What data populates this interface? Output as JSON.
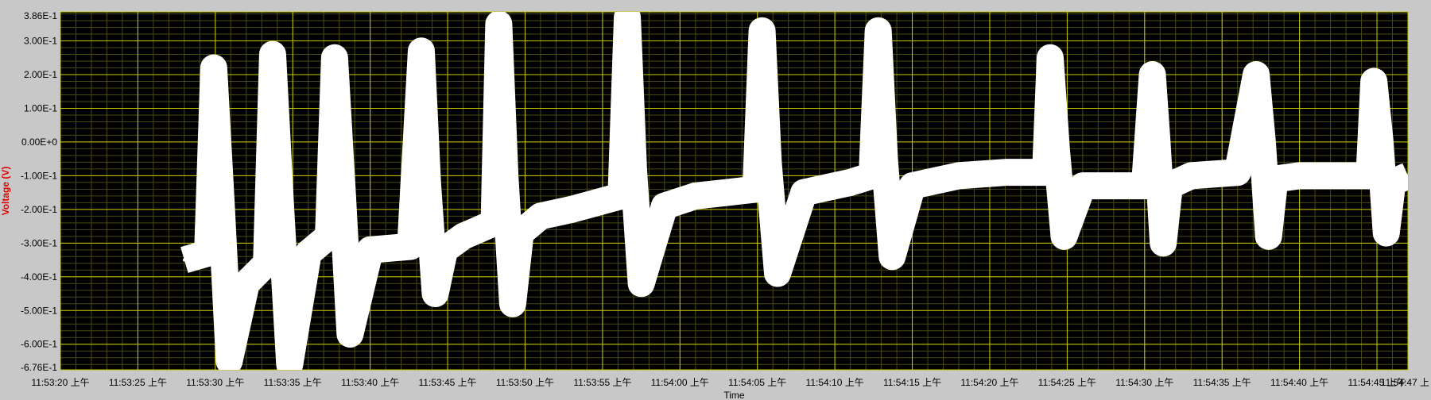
{
  "chart_data": {
    "type": "line",
    "xlabel": "Time",
    "ylabel": "Voltage (V)",
    "ylim": [
      -0.676,
      0.386
    ],
    "xlim": [
      "11:53:20",
      "11:54:47"
    ],
    "grid": true,
    "colors": {
      "plot_background": "#000000",
      "major_grid": "#c8c800",
      "minor_grid": "#4a4a10",
      "signal": "#ffffff",
      "frame": "#c8c8c8",
      "ylabel_color": "#e00000"
    },
    "y_ticks": [
      {
        "value": 0.386,
        "label": "3.86E-1"
      },
      {
        "value": 0.3,
        "label": "3.00E-1"
      },
      {
        "value": 0.2,
        "label": "2.00E-1"
      },
      {
        "value": 0.1,
        "label": "1.00E-1"
      },
      {
        "value": 0.0,
        "label": "0.00E+0"
      },
      {
        "value": -0.1,
        "label": "-1.00E-1"
      },
      {
        "value": -0.2,
        "label": "-2.00E-1"
      },
      {
        "value": -0.3,
        "label": "-3.00E-1"
      },
      {
        "value": -0.4,
        "label": "-4.00E-1"
      },
      {
        "value": -0.5,
        "label": "-5.00E-1"
      },
      {
        "value": -0.6,
        "label": "-6.00E-1"
      },
      {
        "value": -0.676,
        "label": "-6.76E-1"
      }
    ],
    "x_ticks": [
      {
        "value": "11:53:20",
        "label": "11:53:20 上午"
      },
      {
        "value": "11:53:25",
        "label": "11:53:25 上午"
      },
      {
        "value": "11:53:30",
        "label": "11:53:30 上午"
      },
      {
        "value": "11:53:35",
        "label": "11:53:35 上午"
      },
      {
        "value": "11:53:40",
        "label": "11:53:40 上午"
      },
      {
        "value": "11:53:45",
        "label": "11:53:45 上午"
      },
      {
        "value": "11:53:50",
        "label": "11:53:50 上午"
      },
      {
        "value": "11:53:55",
        "label": "11:53:55 上午"
      },
      {
        "value": "11:54:00",
        "label": "11:54:00 上午"
      },
      {
        "value": "11:54:05",
        "label": "11:54:05 上午"
      },
      {
        "value": "11:54:10",
        "label": "11:54:10 上午"
      },
      {
        "value": "11:54:15",
        "label": "11:54:15 上午"
      },
      {
        "value": "11:54:20",
        "label": "11:54:20 上午"
      },
      {
        "value": "11:54:25",
        "label": "11:54:25 上午"
      },
      {
        "value": "11:54:30",
        "label": "11:54:30 上午"
      },
      {
        "value": "11:54:35",
        "label": "11:54:35 上午"
      },
      {
        "value": "11:54:40",
        "label": "11:54:40 上午"
      },
      {
        "value": "11:54:45",
        "label": "11:54:45 上午"
      },
      {
        "value": "11:54:47",
        "label": "11:54:47 上"
      }
    ],
    "series": [
      {
        "x": [
          "11:53:28.0",
          "11:53:29.5",
          "11:53:29.9",
          "11:53:30.4",
          "11:53:30.9",
          "11:53:32.0",
          "11:53:33.3",
          "11:53:33.7",
          "11:53:34.2",
          "11:53:34.8",
          "11:53:36.0",
          "11:53:37.3",
          "11:53:37.7",
          "11:53:38.2",
          "11:53:38.7",
          "11:53:40.0",
          "11:53:42.6",
          "11:53:43.3",
          "11:53:43.7",
          "11:53:44.2",
          "11:53:44.8",
          "11:53:46.0",
          "11:53:48.0",
          "11:53:48.3",
          "11:53:48.7",
          "11:53:49.2",
          "11:53:49.7",
          "11:53:51.0",
          "11:53:53.0",
          "11:53:56.2",
          "11:53:56.6",
          "11:53:57.0",
          "11:53:57.5",
          "11:53:59.0",
          "11:54:01.0",
          "11:54:03.0",
          "11:54:04.9",
          "11:54:05.3",
          "11:54:05.7",
          "11:54:06.3",
          "11:54:08.0",
          "11:54:11.0",
          "11:54:12.4",
          "11:54:12.8",
          "11:54:13.2",
          "11:54:13.7",
          "11:54:15.0",
          "11:54:18.0",
          "11:54:21.0",
          "11:54:23.6",
          "11:54:23.9",
          "11:54:24.3",
          "11:54:24.8",
          "11:54:26.0",
          "11:54:30.0",
          "11:54:30.5",
          "11:54:30.8",
          "11:54:31.2",
          "11:54:31.6",
          "11:54:33.0",
          "11:54:36.0",
          "11:54:37.2",
          "11:54:37.6",
          "11:54:38.0",
          "11:54:38.4",
          "11:54:40.0",
          "11:54:44.5",
          "11:54:44.8",
          "11:54:45.2",
          "11:54:45.6",
          "11:54:46.0",
          "11:54:47.0"
        ],
        "y": [
          -0.35,
          -0.33,
          0.22,
          -0.2,
          -0.65,
          -0.42,
          -0.36,
          0.26,
          -0.18,
          -0.66,
          -0.33,
          -0.28,
          0.25,
          -0.15,
          -0.57,
          -0.32,
          -0.31,
          0.27,
          -0.12,
          -0.45,
          -0.32,
          -0.28,
          -0.24,
          0.35,
          -0.1,
          -0.48,
          -0.27,
          -0.22,
          -0.2,
          -0.16,
          0.37,
          -0.08,
          -0.42,
          -0.19,
          -0.16,
          -0.15,
          -0.14,
          0.33,
          -0.06,
          -0.39,
          -0.15,
          -0.12,
          -0.1,
          0.33,
          -0.05,
          -0.34,
          -0.13,
          -0.1,
          -0.09,
          -0.09,
          0.25,
          -0.02,
          -0.28,
          -0.13,
          -0.13,
          0.2,
          0.0,
          -0.3,
          -0.13,
          -0.1,
          -0.09,
          0.2,
          0.0,
          -0.28,
          -0.11,
          -0.1,
          -0.1,
          0.18,
          0.0,
          -0.27,
          -0.12,
          -0.1
        ]
      }
    ]
  }
}
